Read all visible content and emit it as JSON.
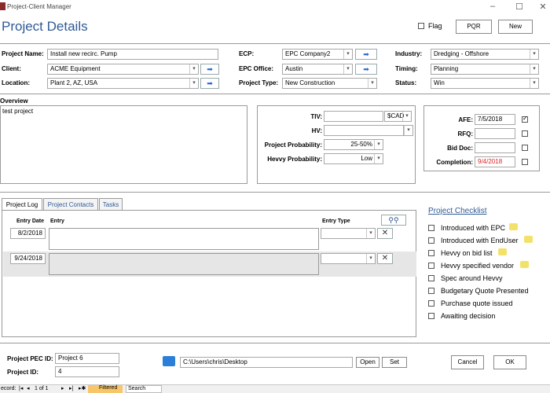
{
  "window": {
    "title": "Project-Client Manager"
  },
  "header": {
    "title": "Project Details",
    "flag_label": "Flag",
    "pqr_label": "PQR",
    "new_label": "New"
  },
  "form": {
    "project_name_label": "Project Name:",
    "project_name": "Install new recirc. Pump",
    "client_label": "Client:",
    "client": "ACME Equipment",
    "location_label": "Location:",
    "location": "Plant 2, AZ, USA",
    "ecp_label": "ECP:",
    "ecp": "EPC Company2",
    "epc_office_label": "EPC Office:",
    "epc_office": "Austin",
    "project_type_label": "Project Type:",
    "project_type": "New Construction",
    "industry_label": "Industry:",
    "industry": "Dredging - Offshore",
    "timing_label": "Timing:",
    "timing": "Planning",
    "status_label": "Status:",
    "status": "Win"
  },
  "overview": {
    "label": "Overview",
    "text": "test project"
  },
  "values": {
    "tiv_label": "TIV:",
    "currency": "$CAD",
    "hv_label": "HV:",
    "probability_label": "Project Probability:",
    "probability": "25-50%",
    "hevvy_prob_label": "Hevvy Probability:",
    "hevvy_prob": "Low"
  },
  "dates": {
    "afe_label": "AFE:",
    "afe": "7/5/2018",
    "rfq_label": "RFQ:",
    "bid_doc_label": "Bid Doc:",
    "completion_label": "Completion:",
    "completion": "9/4/2018"
  },
  "tabs": {
    "log": "Project Log",
    "contacts": "Project Contacts",
    "tasks": "Tasks"
  },
  "log": {
    "col_date": "Entry Date",
    "col_entry": "Entry",
    "col_type": "Entry Type",
    "rows": [
      {
        "date": "8/2/2018"
      },
      {
        "date": "9/24/2018"
      }
    ]
  },
  "checklist": {
    "title": "Project Checklist",
    "items": [
      "Introduced with EPC",
      "Introduced with EndUser",
      "Hevvy on bid list",
      "Hevvy specified vendor",
      "Spec around Hevvy",
      "Budgetary Quote Presented",
      "Purchase quote issued",
      "Awaiting decision"
    ]
  },
  "footer": {
    "pec_id_label": "Project PEC ID:",
    "pec_id": "Project 6",
    "project_id_label": "Project ID:",
    "project_id": "4",
    "path": "C:\\Users\\chris\\Desktop",
    "open_label": "Open",
    "set_label": "Set",
    "cancel_label": "Cancel",
    "ok_label": "OK"
  },
  "statusbar": {
    "record_label": "ecord:",
    "position": "1 of 1",
    "filtered": "Filtered",
    "search": "Search"
  }
}
